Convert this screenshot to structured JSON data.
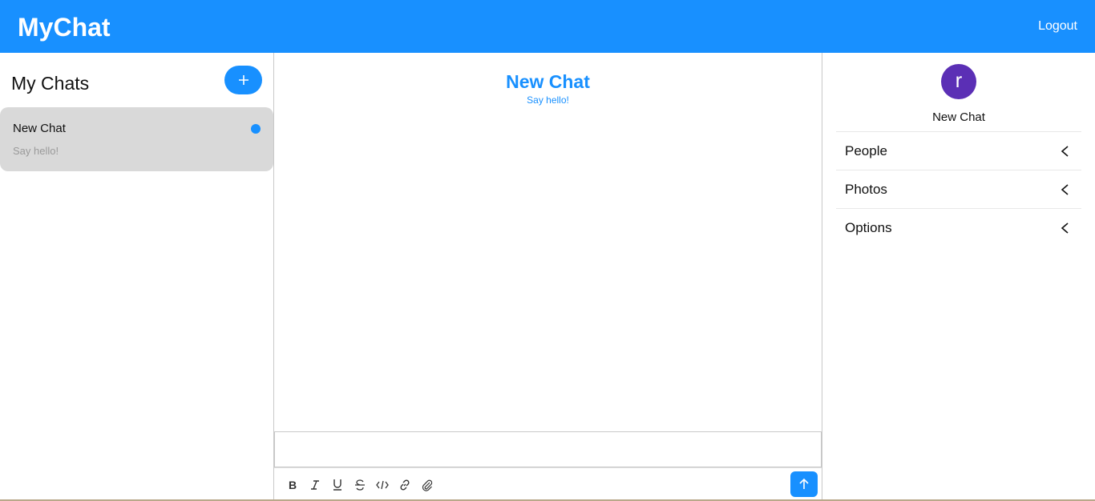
{
  "header": {
    "brand": "MyChat",
    "logout_label": "Logout"
  },
  "sidebar": {
    "title": "My Chats",
    "new_chat_icon": "plus-icon",
    "chats": [
      {
        "title": "New Chat",
        "preview": "Say hello!",
        "unread": true
      }
    ]
  },
  "feed": {
    "title": "New Chat",
    "subtitle": "Say hello!",
    "input_value": "",
    "toolbar_icons": [
      "bold-icon",
      "italic-icon",
      "underline-icon",
      "strikethrough-icon",
      "code-icon",
      "link-icon",
      "attachment-icon"
    ],
    "send_icon": "arrow-up-icon"
  },
  "settings": {
    "avatar_letter": "r",
    "title": "New Chat",
    "sections": [
      {
        "label": "People"
      },
      {
        "label": "Photos"
      },
      {
        "label": "Options"
      }
    ]
  },
  "colors": {
    "accent": "#1890ff",
    "avatar_bg": "#5b2fb5",
    "card_bg": "#d9d9d9"
  }
}
